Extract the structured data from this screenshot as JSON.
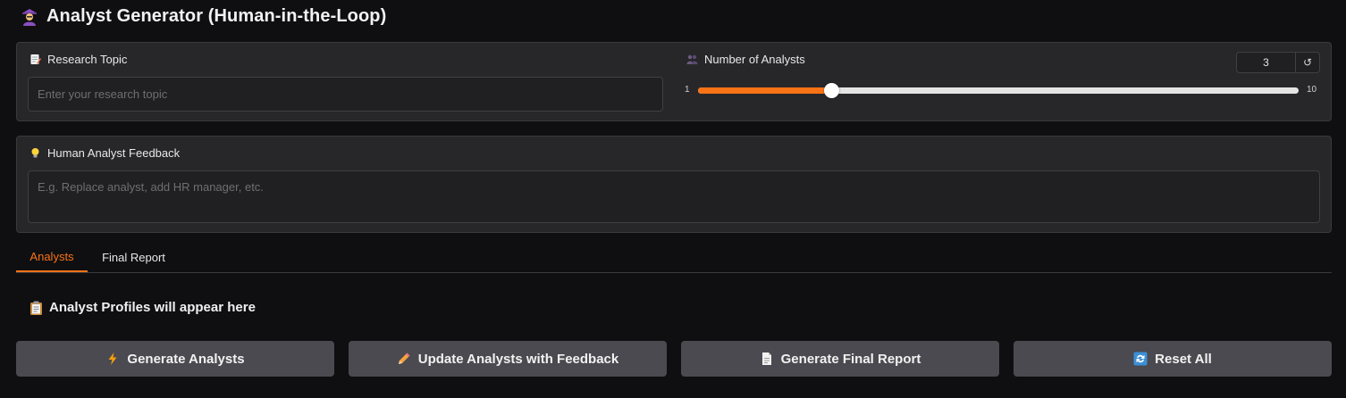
{
  "app": {
    "title": "Analyst Generator (Human-in-the-Loop)"
  },
  "topic": {
    "label": "Research Topic",
    "placeholder": "Enter your research topic",
    "value": ""
  },
  "analysts_count": {
    "label": "Number of Analysts",
    "value": "3",
    "min": "1",
    "max": "10",
    "reset_symbol": "↺"
  },
  "feedback": {
    "label": "Human Analyst Feedback",
    "placeholder": "E.g. Replace analyst, add HR manager, etc.",
    "value": ""
  },
  "tabs": [
    {
      "label": "Analysts",
      "active": true
    },
    {
      "label": "Final Report",
      "active": false
    }
  ],
  "section": {
    "title": "Analyst Profiles will appear here"
  },
  "buttons": {
    "generate": "Generate Analysts",
    "update": "Update Analysts with Feedback",
    "final": "Generate Final Report",
    "reset": "Reset All"
  },
  "colors": {
    "accent": "#f97316",
    "background": "#0f0f11",
    "panel": "#27272a",
    "button": "#4a4a50"
  },
  "icons": {
    "title": "detective-icon",
    "topic": "memo-icon",
    "count": "people-icon",
    "feedback": "lightbulb-icon",
    "section": "clipboard-icon",
    "generate": "lightning-icon",
    "update": "pencil-icon",
    "final": "document-icon",
    "reset": "refresh-icon"
  }
}
